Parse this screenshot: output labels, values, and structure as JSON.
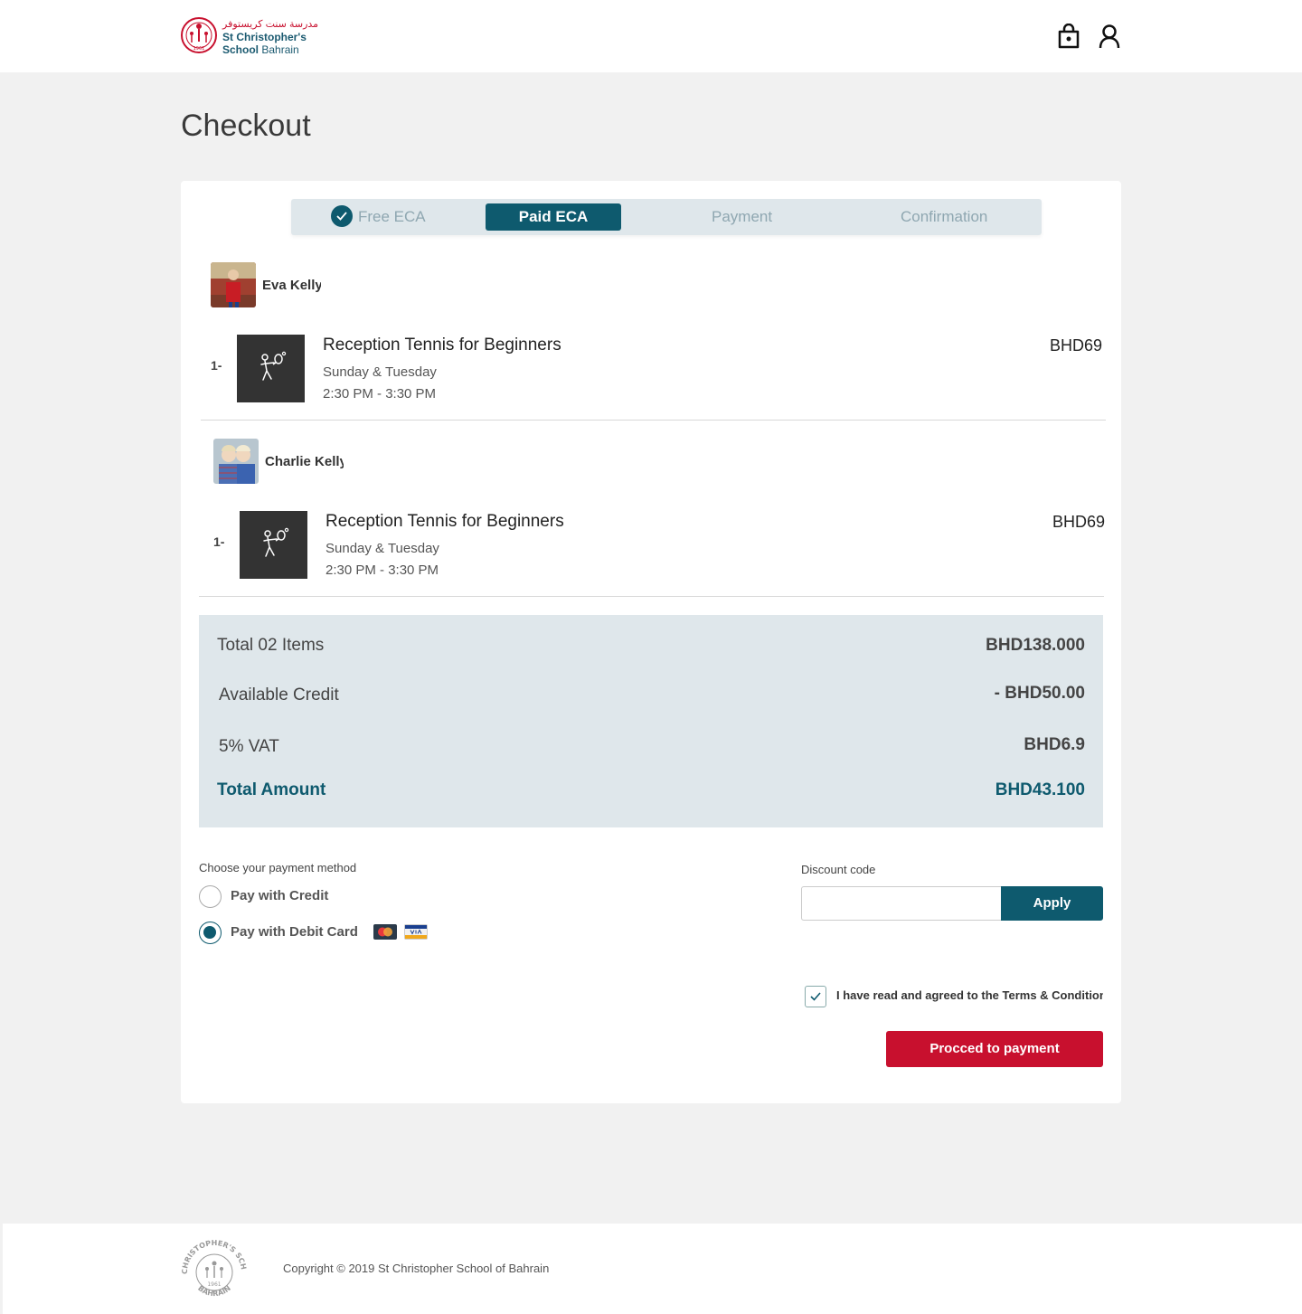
{
  "header": {
    "logo_ar": "مدرسة سنت كريستوفر",
    "logo_line1": "St Christopher's",
    "logo_line2a": "School",
    "logo_line2b": "Bahrain",
    "logo_year": "1961"
  },
  "page": {
    "title": "Checkout"
  },
  "stepper": {
    "steps": [
      {
        "label": "Free ECA",
        "state": "done"
      },
      {
        "label": "Paid ECA",
        "state": "active"
      },
      {
        "label": "Payment",
        "state": "pending"
      },
      {
        "label": "Confirmation",
        "state": "pending"
      }
    ]
  },
  "children": [
    {
      "name": "Eva Kelly",
      "items": [
        {
          "index": "1-",
          "title": "Reception Tennis for Beginners",
          "days": "Sunday & Tuesday",
          "time": "2:30 PM - 3:30 PM",
          "price": "BHD69"
        }
      ]
    },
    {
      "name": "Charlie Kelly",
      "items": [
        {
          "index": "1-",
          "title": "Reception Tennis for Beginners",
          "days": "Sunday & Tuesday",
          "time": "2:30 PM - 3:30 PM",
          "price": "BHD69"
        }
      ]
    }
  ],
  "summary": {
    "total_items_label": "Total 02 Items",
    "total_items_value": "BHD138.000",
    "credit_label": "Available Credit",
    "credit_value": "- BHD50.00",
    "vat_label": "5% VAT",
    "vat_value": "BHD6.9",
    "total_label": "Total Amount",
    "total_value": "BHD43.100"
  },
  "payment": {
    "label": "Choose your payment method",
    "options": [
      {
        "label": "Pay with Credit",
        "selected": false
      },
      {
        "label": "Pay with Debit Card",
        "selected": true
      }
    ]
  },
  "discount": {
    "label": "Discount code",
    "value": "",
    "apply_label": "Apply"
  },
  "terms": {
    "label": "I have read and agreed to the Terms & Conditions",
    "checked": true
  },
  "proceed_label": "Procced to payment",
  "footer": {
    "copyright": "Copyright © 2019 St Christopher School of Bahrain",
    "seal_text": "ST CHRISTOPHER'S SCHOOL",
    "seal_bottom": "BAHRAIN",
    "seal_year": "1961"
  },
  "colors": {
    "primary": "#0e5a6e",
    "accent": "#c8102e",
    "summary_bg": "#dfe7eb"
  },
  "icons": {
    "bag": "shopping-bag-icon",
    "user": "user-icon",
    "activity": "tennis-player-icon",
    "check": "check-icon"
  }
}
